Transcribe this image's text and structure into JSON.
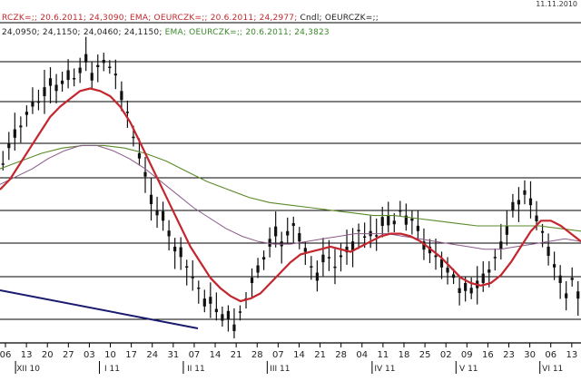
{
  "header": {
    "date_stamp": "11.11.2010"
  },
  "legend": {
    "line1": [
      {
        "text": "RCZK=;; 20.6.2011; 24,3090; EMA; OEURCZK=;; 20.6.2011; 24,2977; ",
        "color": "#c0282c"
      },
      {
        "text": "Cndl; OEURCZK=;;",
        "color": "#222222"
      }
    ],
    "line2": [
      {
        "text": "24,0950; 24,1150; 24,0460; 24,1150; ",
        "color": "#222222"
      },
      {
        "text": "EMA; OEURCZK=;; 20.6.2011; 24,3823",
        "color": "#3a8a2a"
      }
    ]
  },
  "colors": {
    "candle": "#111111",
    "ema_red": "#c4262e",
    "ema_purple": "#8a5a8a",
    "ema_green": "#5a8a2a",
    "trendline": "#1a1a6e",
    "grid": "#000000",
    "axis": "#000000"
  },
  "chart_data": {
    "type": "candlestick",
    "x_day_ticks": [
      "06",
      "13",
      "20",
      "27",
      "03",
      "10",
      "17",
      "24",
      "31",
      "07",
      "14",
      "21",
      "28",
      "07",
      "14",
      "21",
      "28",
      "04",
      "11",
      "18",
      "25",
      "02",
      "09",
      "16",
      "23",
      "30",
      "06",
      "13"
    ],
    "month_labels": [
      {
        "label": "XII 10",
        "tick_index": 1
      },
      {
        "label": "I 11",
        "tick_index": 5
      },
      {
        "label": "II 11",
        "tick_index": 9
      },
      {
        "label": "III 11",
        "tick_index": 13
      },
      {
        "label": "IV 11",
        "tick_index": 18
      },
      {
        "label": "V 11",
        "tick_index": 22
      },
      {
        "label": "VI 11",
        "tick_index": 26
      }
    ],
    "y_grid_levels": [
      0.0,
      0.125,
      0.25,
      0.375,
      0.5,
      0.625,
      0.75,
      0.875,
      1.0
    ],
    "candles_close": [
      0.6,
      0.66,
      0.7,
      0.74,
      0.8,
      0.82,
      0.84,
      0.86,
      0.9,
      0.88,
      0.92,
      0.96,
      0.93,
      0.97,
      0.99,
      0.95,
      0.98,
      1.0,
      0.97,
      0.94,
      0.88,
      0.8,
      0.7,
      0.62,
      0.55,
      0.48,
      0.42,
      0.38,
      0.32,
      0.28,
      0.24,
      0.2,
      0.16,
      0.12,
      0.08,
      0.06,
      0.04,
      0.02,
      0.0,
      -0.02,
      0.03,
      0.08,
      0.14,
      0.18,
      0.24,
      0.28,
      0.32,
      0.3,
      0.34,
      0.36,
      0.3,
      0.26,
      0.2,
      0.18,
      0.22,
      0.24,
      0.2,
      0.24,
      0.28,
      0.3,
      0.34,
      0.32,
      0.34,
      0.32,
      0.36,
      0.4,
      0.38,
      0.42,
      0.4,
      0.38,
      0.34,
      0.3,
      0.28,
      0.24,
      0.2,
      0.18,
      0.16,
      0.12,
      0.14,
      0.1,
      0.12,
      0.14,
      0.18,
      0.24,
      0.3,
      0.36,
      0.42,
      0.46,
      0.48,
      0.44,
      0.4,
      0.34,
      0.28,
      0.2,
      0.14,
      0.1,
      0.16,
      0.08
    ],
    "ema_red": [
      0.5,
      0.54,
      0.6,
      0.66,
      0.72,
      0.78,
      0.82,
      0.85,
      0.88,
      0.89,
      0.88,
      0.86,
      0.82,
      0.76,
      0.68,
      0.6,
      0.52,
      0.44,
      0.36,
      0.28,
      0.22,
      0.16,
      0.12,
      0.09,
      0.07,
      0.08,
      0.1,
      0.14,
      0.18,
      0.22,
      0.25,
      0.26,
      0.27,
      0.28,
      0.27,
      0.26,
      0.28,
      0.3,
      0.32,
      0.33,
      0.33,
      0.32,
      0.3,
      0.27,
      0.24,
      0.2,
      0.16,
      0.14,
      0.13,
      0.14,
      0.17,
      0.22,
      0.28,
      0.34,
      0.38,
      0.38,
      0.36,
      0.33,
      0.3
    ],
    "ema_purple": [
      0.52,
      0.55,
      0.58,
      0.62,
      0.65,
      0.67,
      0.67,
      0.65,
      0.62,
      0.58,
      0.53,
      0.48,
      0.43,
      0.39,
      0.35,
      0.32,
      0.3,
      0.29,
      0.29,
      0.3,
      0.31,
      0.32,
      0.33,
      0.33,
      0.33,
      0.32,
      0.31,
      0.3,
      0.29,
      0.28,
      0.27,
      0.27,
      0.28,
      0.29,
      0.3,
      0.31,
      0.3
    ],
    "ema_green": [
      0.58,
      0.61,
      0.64,
      0.66,
      0.67,
      0.67,
      0.66,
      0.64,
      0.61,
      0.57,
      0.53,
      0.5,
      0.47,
      0.45,
      0.44,
      0.43,
      0.42,
      0.41,
      0.4,
      0.4,
      0.39,
      0.38,
      0.37,
      0.36,
      0.36,
      0.36,
      0.36,
      0.35,
      0.34
    ],
    "trendline": [
      [
        -1.0,
        -0.04
      ],
      [
        0.34,
        -0.14
      ]
    ]
  }
}
